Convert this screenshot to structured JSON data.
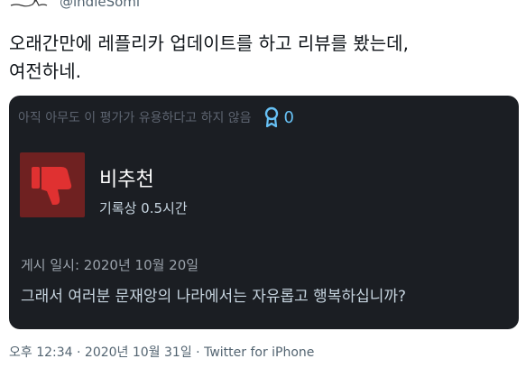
{
  "tweet": {
    "handle": "@indieSomi",
    "text": "오래간만에 레플리카 업데이트를 하고 리뷰를 봤는데,\n여전하네.",
    "timestamp": "오후 12:34 · 2020년 10월 31일",
    "separator": "·",
    "source": "Twitter for iPhone"
  },
  "review": {
    "helpful_text": "아직 아무도 이 평가가 유용하다고 하지 않음",
    "award_count": "0",
    "verdict": "비추천",
    "hours": "기록상 0.5시간",
    "posted": "게시 일시: 2020년 10월 20일",
    "body": "그래서 여러분 문재앙의 나라에서는 자유롭고 행복하십니까?"
  },
  "colors": {
    "card_bg": "#1b1e23",
    "thumb_bg": "#6f2121",
    "thumb_icon": "#e03131",
    "award_blue": "#67c1f5",
    "meta_gray": "#536471"
  },
  "icons": {
    "avatar": "avatar-logo",
    "award": "award-ribbon-icon",
    "thumb": "thumbs-down-icon"
  }
}
